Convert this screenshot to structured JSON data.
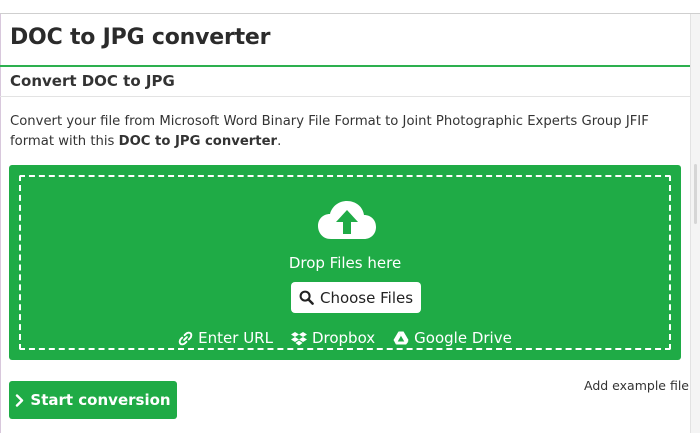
{
  "page": {
    "title": "DOC to JPG converter",
    "section_title": "Convert DOC to JPG",
    "description_prefix": "Convert your file from Microsoft Word Binary File Format to Joint Photographic Experts Group JFIF format with this ",
    "description_bold": "DOC to JPG converter",
    "description_suffix": "."
  },
  "upload": {
    "drop_text": "Drop Files here",
    "choose_label": "Choose Files",
    "sources": [
      {
        "label": "Enter URL",
        "icon": "link-icon"
      },
      {
        "label": "Dropbox",
        "icon": "dropbox-icon"
      },
      {
        "label": "Google Drive",
        "icon": "google-drive-icon"
      }
    ]
  },
  "actions": {
    "start_label": "Start conversion",
    "example_label": "Add example file"
  },
  "colors": {
    "accent": "#1fab46",
    "rule": "#2db04f"
  }
}
